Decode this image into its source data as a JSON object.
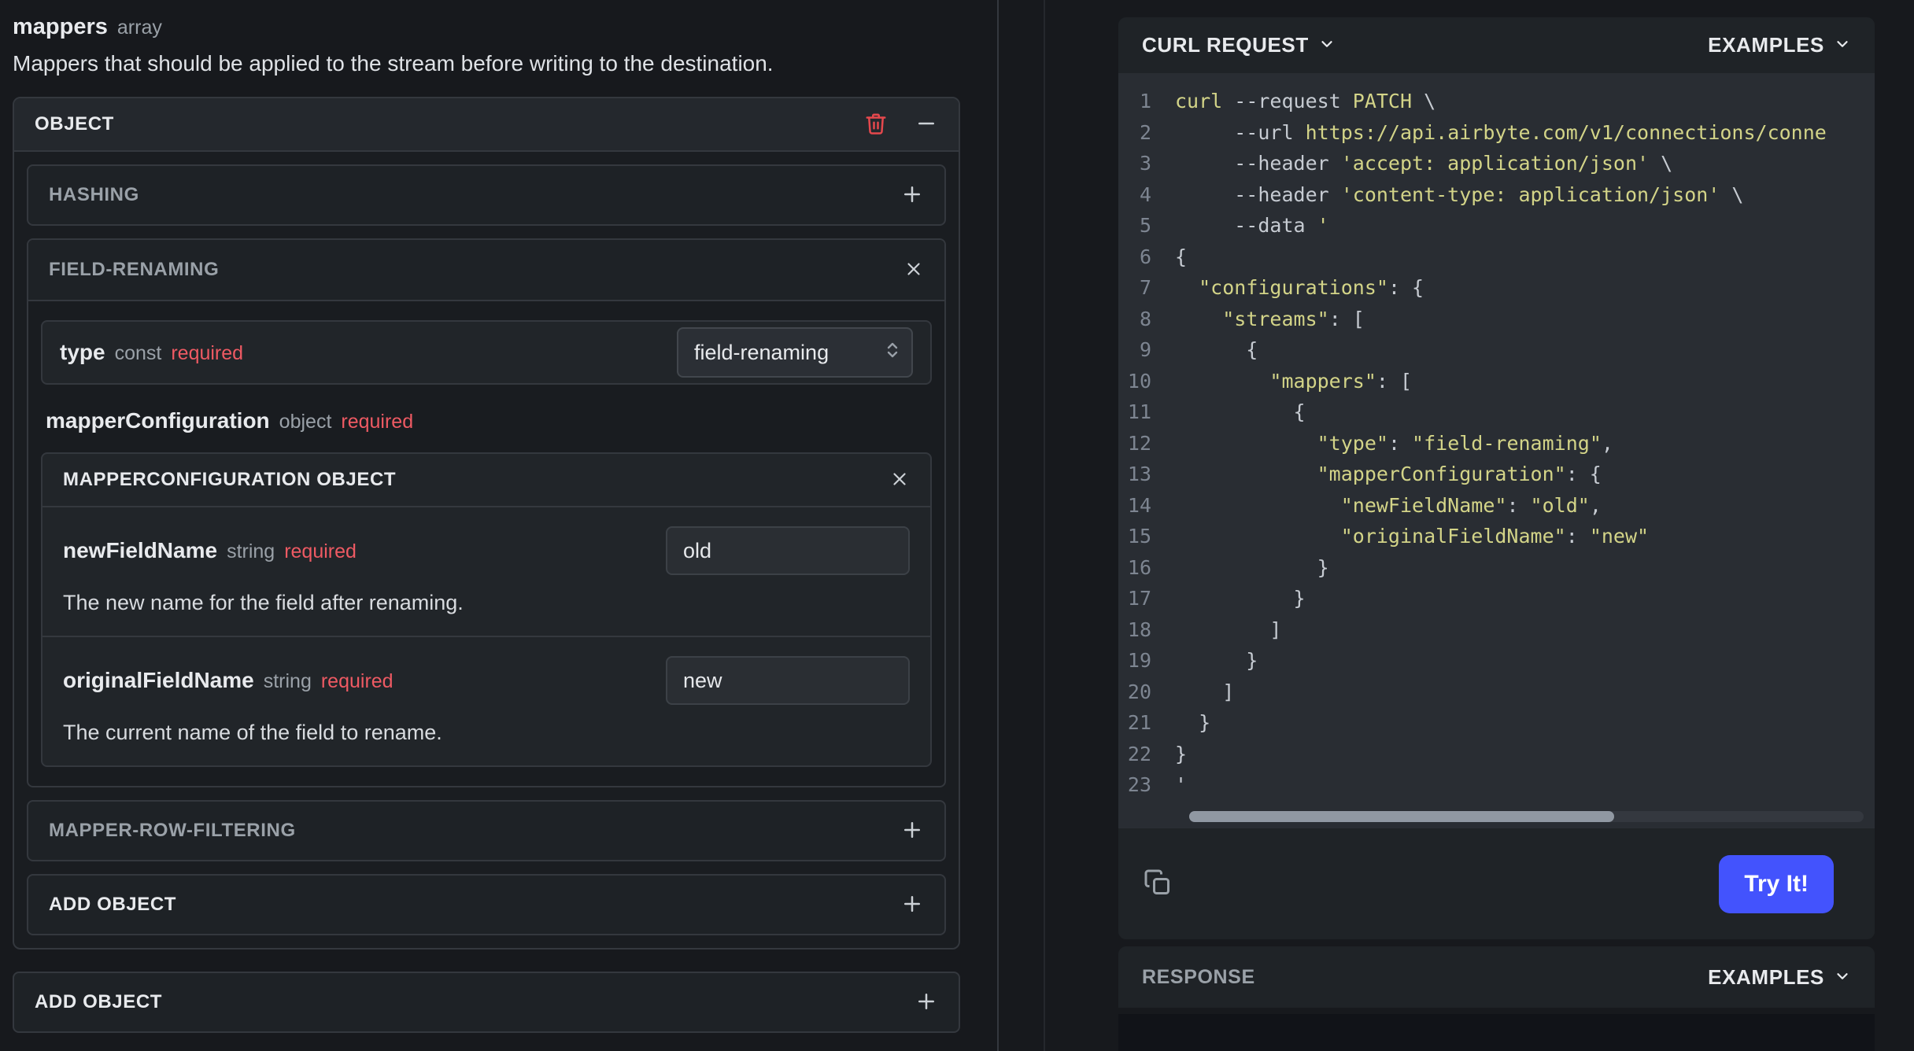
{
  "left": {
    "param_name": "mappers",
    "param_type": "array",
    "description": "Mappers that should be applied to the stream before writing to the destination.",
    "object_header": "OBJECT",
    "hashing_label": "HASHING",
    "field_renaming_label": "FIELD-RENAMING",
    "type_field": {
      "name": "type",
      "kind": "const",
      "required": "required",
      "value": "field-renaming"
    },
    "mapper_config": {
      "name": "mapperConfiguration",
      "kind": "object",
      "required": "required"
    },
    "nested_header": "MAPPERCONFIGURATION OBJECT",
    "new_field": {
      "name": "newFieldName",
      "kind": "string",
      "required": "required",
      "value": "old",
      "description": "The new name for the field after renaming."
    },
    "original_field": {
      "name": "originalFieldName",
      "kind": "string",
      "required": "required",
      "value": "new",
      "description": "The current name of the field to rename."
    },
    "row_filtering_label": "MAPPER-ROW-FILTERING",
    "add_object_inner_label": "ADD OBJECT",
    "add_object_outer_label": "ADD OBJECT"
  },
  "request_panel": {
    "title": "CURL REQUEST",
    "examples_label": "EXAMPLES",
    "try_it_label": "Try It!"
  },
  "response_panel": {
    "title": "RESPONSE",
    "examples_label": "EXAMPLES"
  },
  "code": {
    "lines": [
      {
        "n": "1",
        "t": [
          [
            "s",
            "curl "
          ],
          [
            "p",
            "--request "
          ],
          [
            "s",
            "PATCH "
          ],
          [
            "p",
            "\\"
          ]
        ]
      },
      {
        "n": "2",
        "t": [
          [
            "p",
            "     --url "
          ],
          [
            "s",
            "https://api.airbyte.com/v1/connections/conne"
          ]
        ]
      },
      {
        "n": "3",
        "t": [
          [
            "p",
            "     --header "
          ],
          [
            "s",
            "'accept: application/json'"
          ],
          [
            "p",
            " \\"
          ]
        ]
      },
      {
        "n": "4",
        "t": [
          [
            "p",
            "     --header "
          ],
          [
            "s",
            "'content-type: application/json'"
          ],
          [
            "p",
            " \\"
          ]
        ]
      },
      {
        "n": "5",
        "t": [
          [
            "p",
            "     --data "
          ],
          [
            "s",
            "'"
          ]
        ]
      },
      {
        "n": "6",
        "t": [
          [
            "p",
            "{"
          ]
        ]
      },
      {
        "n": "7",
        "t": [
          [
            "p",
            "  "
          ],
          [
            "s",
            "\"configurations\""
          ],
          [
            "p",
            ": {"
          ]
        ]
      },
      {
        "n": "8",
        "t": [
          [
            "p",
            "    "
          ],
          [
            "s",
            "\"streams\""
          ],
          [
            "p",
            ": ["
          ]
        ]
      },
      {
        "n": "9",
        "t": [
          [
            "p",
            "      {"
          ]
        ]
      },
      {
        "n": "10",
        "t": [
          [
            "p",
            "        "
          ],
          [
            "s",
            "\"mappers\""
          ],
          [
            "p",
            ": ["
          ]
        ]
      },
      {
        "n": "11",
        "t": [
          [
            "p",
            "          {"
          ]
        ]
      },
      {
        "n": "12",
        "t": [
          [
            "p",
            "            "
          ],
          [
            "s",
            "\"type\""
          ],
          [
            "p",
            ": "
          ],
          [
            "s",
            "\"field-renaming\""
          ],
          [
            "p",
            ","
          ]
        ]
      },
      {
        "n": "13",
        "t": [
          [
            "p",
            "            "
          ],
          [
            "s",
            "\"mapperConfiguration\""
          ],
          [
            "p",
            ": {"
          ]
        ]
      },
      {
        "n": "14",
        "t": [
          [
            "p",
            "              "
          ],
          [
            "s",
            "\"newFieldName\""
          ],
          [
            "p",
            ": "
          ],
          [
            "s",
            "\"old\""
          ],
          [
            "p",
            ","
          ]
        ]
      },
      {
        "n": "15",
        "t": [
          [
            "p",
            "              "
          ],
          [
            "s",
            "\"originalFieldName\""
          ],
          [
            "p",
            ": "
          ],
          [
            "s",
            "\"new\""
          ]
        ]
      },
      {
        "n": "16",
        "t": [
          [
            "p",
            "            }"
          ]
        ]
      },
      {
        "n": "17",
        "t": [
          [
            "p",
            "          }"
          ]
        ]
      },
      {
        "n": "18",
        "t": [
          [
            "p",
            "        ]"
          ]
        ]
      },
      {
        "n": "19",
        "t": [
          [
            "p",
            "      }"
          ]
        ]
      },
      {
        "n": "20",
        "t": [
          [
            "p",
            "    ]"
          ]
        ]
      },
      {
        "n": "21",
        "t": [
          [
            "p",
            "  }"
          ]
        ]
      },
      {
        "n": "22",
        "t": [
          [
            "p",
            "}"
          ]
        ]
      },
      {
        "n": "23",
        "t": [
          [
            "p",
            "'"
          ]
        ]
      }
    ]
  },
  "colors": {
    "accent": "#4353fd",
    "required": "#ee5a63",
    "danger": "#e5484d",
    "code_string": "#d3d488",
    "code_plain": "#c6cbd2",
    "line_number": "#7d8591"
  }
}
